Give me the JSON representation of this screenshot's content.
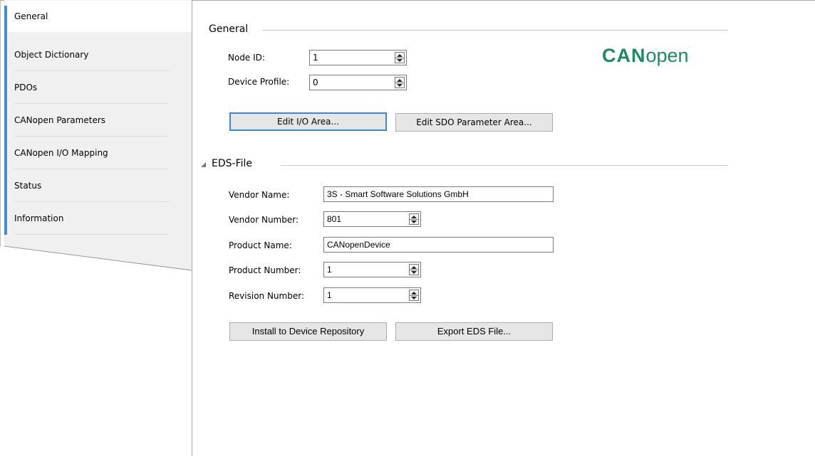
{
  "sidebar": {
    "tabs": [
      {
        "label": "General",
        "active": true
      },
      {
        "label": "Object Dictionary",
        "active": false
      },
      {
        "label": "PDOs",
        "active": false
      },
      {
        "label": "CANopen Parameters",
        "active": false
      },
      {
        "label": "CANopen I/O Mapping",
        "active": false
      },
      {
        "label": "Status",
        "active": false
      },
      {
        "label": "Information",
        "active": false
      }
    ]
  },
  "general": {
    "title": "General",
    "node_id_label": "Node ID:",
    "node_id_value": "1",
    "device_profile_label": "Device Profile:",
    "device_profile_value": "0",
    "edit_io_button": "Edit I/O Area...",
    "edit_sdo_button": "Edit SDO Parameter Area...",
    "logo_bold": "CAN",
    "logo_light": "open"
  },
  "eds": {
    "title": "EDS-File",
    "vendor_name_label": "Vendor Name:",
    "vendor_name_value": "3S - Smart Software Solutions GmbH",
    "vendor_number_label": "Vendor Number:",
    "vendor_number_value": "801",
    "product_name_label": "Product Name:",
    "product_name_value": "CANopenDevice",
    "product_number_label": "Product Number:",
    "product_number_value": "1",
    "revision_number_label": "Revision Number:",
    "revision_number_value": "1",
    "install_button": "Install to Device Repository",
    "export_button": "Export EDS File..."
  },
  "colors": {
    "accent": "#3d8fd8",
    "logo_green": "#1d8a63",
    "sidebar_bg": "#f0f0f0"
  }
}
